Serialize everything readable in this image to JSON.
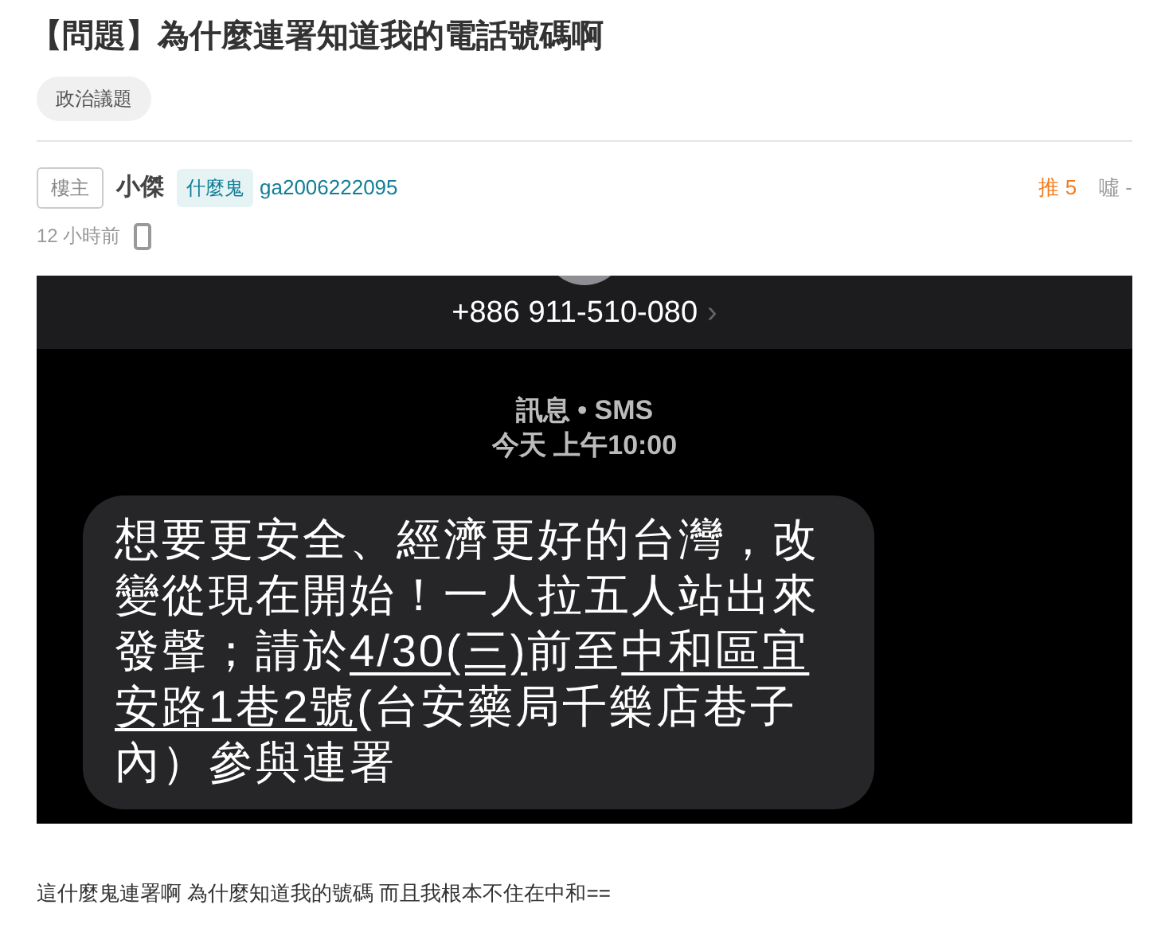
{
  "title": "【問題】為什麼連署知道我的電話號碼啊",
  "tag": "政治議題",
  "author": {
    "role": "樓主",
    "name": "小傑",
    "title_badge": "什麼鬼",
    "account": "ga2006222095"
  },
  "votes": {
    "push": "推 5",
    "boo": "噓 -"
  },
  "time": "12 小時前",
  "sms_screenshot": {
    "sender": "+886 911-510-080",
    "chevron": "›",
    "channel": "訊息 • SMS",
    "timestamp": "今天 上午10:00",
    "message": [
      {
        "text": "想要更安全、經濟更好的台灣，改變從現在開始！一人拉五人站出來發聲；請於",
        "underlined": false
      },
      {
        "text": "4/30(三)",
        "underlined": true
      },
      {
        "text": "前至",
        "underlined": false
      },
      {
        "text": "中和區宜安路1巷2號",
        "underlined": true
      },
      {
        "text": "(台安藥局千樂店巷子內）參與連署",
        "underlined": false
      }
    ]
  },
  "body": "這什麼鬼連署啊 為什麼知道我的號碼 而且我根本不住在中和=="
}
